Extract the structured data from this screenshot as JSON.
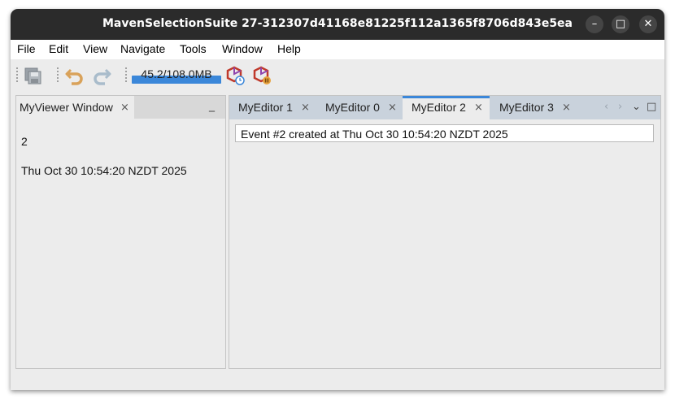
{
  "window": {
    "title": "MavenSelectionSuite 27-312307d41168e81225f112a1365f8706d843e5ea",
    "controls": {
      "minimize": "–",
      "maximize": "□",
      "close": "✕"
    }
  },
  "menubar": {
    "items": [
      "File",
      "Edit",
      "View",
      "Navigate",
      "Tools",
      "Window",
      "Help"
    ]
  },
  "toolbar": {
    "icons": [
      "save-all-icon",
      "undo-icon",
      "redo-icon",
      "profile-icon",
      "pause-profile-icon"
    ],
    "memory": {
      "label": "45.2/108.0MB",
      "used_mb": 45.2,
      "total_mb": 108.0
    }
  },
  "left_panel": {
    "tab_label": "MyViewer Window",
    "close": "×",
    "minimize": "_",
    "value": "2",
    "timestamp": "Thu Oct 30 10:54:20 NZDT 2025"
  },
  "editor": {
    "tabs": [
      {
        "label": "MyEditor 1",
        "close": "×"
      },
      {
        "label": "MyEditor 0",
        "close": "×"
      },
      {
        "label": "MyEditor 2",
        "close": "×",
        "active": true
      },
      {
        "label": "MyEditor 3",
        "close": "×"
      }
    ],
    "nav": {
      "prev": "‹",
      "next": "›",
      "dropdown": "⌄",
      "maximize": "□"
    },
    "content": "Event #2 created at Thu Oct 30 10:54:20 NZDT 2025"
  },
  "colors": {
    "accent": "#3b87d9",
    "titlebar": "#2b2b2b",
    "tabbar": "#c9d2dc"
  }
}
